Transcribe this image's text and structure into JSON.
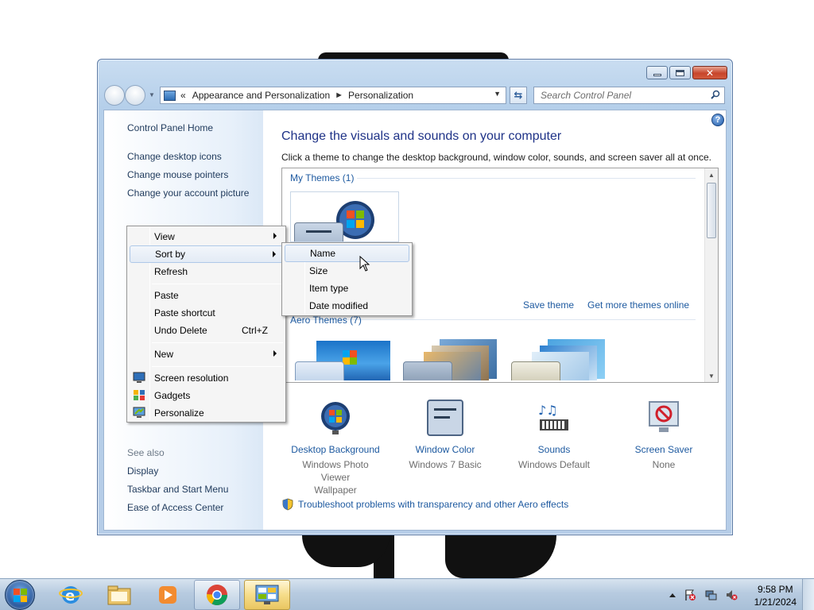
{
  "window": {
    "breadcrumb_prefix": "«",
    "breadcrumb": [
      "Appearance and Personalization",
      "Personalization"
    ],
    "search_placeholder": "Search Control Panel",
    "help_label": "?"
  },
  "left_pane": {
    "home": "Control Panel Home",
    "links": [
      "Change desktop icons",
      "Change mouse pointers",
      "Change your account picture"
    ],
    "see_also_label": "See also",
    "see_also": [
      "Display",
      "Taskbar and Start Menu",
      "Ease of Access Center"
    ]
  },
  "main": {
    "title": "Change the visuals and sounds on your computer",
    "description": "Click a theme to change the desktop background, window color, sounds, and screen saver all at once.",
    "my_themes_label": "My Themes (1)",
    "aero_themes_label": "Aero Themes (7)",
    "save_theme": "Save theme",
    "get_more": "Get more themes online",
    "bottom_items": [
      {
        "label": "Desktop Background",
        "sub1": "Windows Photo Viewer",
        "sub2": "Wallpaper",
        "icon": "desktop-background-icon"
      },
      {
        "label": "Window Color",
        "sub1": "Windows 7 Basic",
        "sub2": "",
        "icon": "window-color-icon"
      },
      {
        "label": "Sounds",
        "sub1": "Windows Default",
        "sub2": "",
        "icon": "sounds-icon"
      },
      {
        "label": "Screen Saver",
        "sub1": "None",
        "sub2": "",
        "icon": "screen-saver-icon"
      }
    ],
    "troubleshoot": "Troubleshoot problems with transparency and other Aero effects"
  },
  "context_menu": {
    "items": [
      {
        "label": "View",
        "submenu": true
      },
      {
        "label": "Sort by",
        "submenu": true,
        "highlighted": true
      },
      {
        "label": "Refresh"
      },
      {
        "label": "Paste"
      },
      {
        "label": "Paste shortcut"
      },
      {
        "label": "Undo Delete",
        "shortcut": "Ctrl+Z"
      },
      {
        "label": "New",
        "submenu": true
      },
      {
        "label": "Screen resolution",
        "icon": "screen-resolution-icon"
      },
      {
        "label": "Gadgets",
        "icon": "gadgets-icon"
      },
      {
        "label": "Personalize",
        "icon": "personalize-icon"
      }
    ]
  },
  "sort_submenu": {
    "items": [
      "Name",
      "Size",
      "Item type",
      "Date modified"
    ],
    "highlighted": "Name"
  },
  "taskbar": {
    "time": "9:58 PM",
    "date": "1/21/2024",
    "apps": [
      "internet-explorer-icon",
      "file-explorer-icon",
      "media-player-icon",
      "chrome-icon",
      "control-panel-icon"
    ]
  },
  "colors": {
    "link": "#1e5aa0",
    "title": "#1e3287",
    "highlight_border": "#aec8e8",
    "taskbar_active": "#f6dd8a"
  }
}
